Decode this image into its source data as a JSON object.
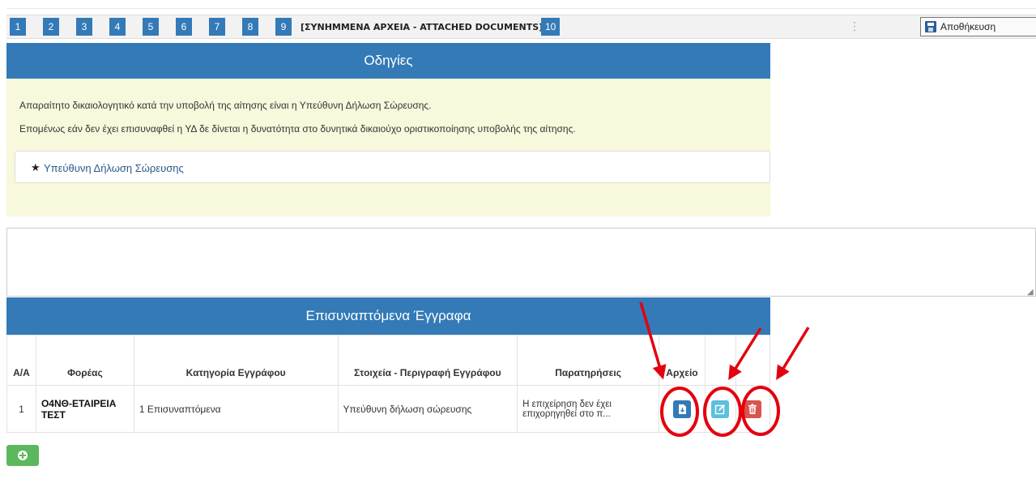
{
  "steps": [
    "1",
    "2",
    "3",
    "4",
    "5",
    "6",
    "7",
    "8",
    "9",
    "10"
  ],
  "current_step_title": "[ΣΥΝΗΜΜΕΝΑ ΑΡΧΕΙΑ - ATTACHED DOCUMENTS]",
  "toolbar": {
    "save_label": "Αποθήκευση"
  },
  "instructions": {
    "title": "Οδηγίες",
    "line1": "Απαραίτητο δικαιολογητικό κατά την υποβολή της αίτησης είναι η Υπεύθυνη Δήλωση Σώρευσης.",
    "line2": "Επομένως εάν δεν έχει επισυναφθεί η ΥΔ δε δίνεται η δυνατότητα στο δυνητικά δικαιούχο οριστικοποίησης υποβολής της αίτησης.",
    "required_doc": "Υπεύθυνη Δήλωση Σώρευσης"
  },
  "documents": {
    "title": "Επισυναπτόμενα Έγγραφα",
    "columns": {
      "aa": "Α/Α",
      "org": "Φορέας",
      "category": "Κατηγορία Εγγράφου",
      "description": "Στοιχεία - Περιγραφή Εγγράφου",
      "notes": "Παρατηρήσεις",
      "file": "Αρχείο"
    },
    "rows": [
      {
        "aa": "1",
        "org": "Ο4ΝΘ-ΕΤΑΙΡΕΙΑ ΤΕΣΤ",
        "category": "1 Επισυναπτόμενα",
        "description": "Υπεύθυνη δήλωση σώρευσης",
        "notes": "Η επιχείρηση δεν έχει επιχορηγηθεί στο π..."
      }
    ]
  },
  "icons": {
    "save": "floppy-disk-icon",
    "star": "star-icon",
    "file": "file-download-icon",
    "edit": "edit-icon",
    "delete": "trash-icon",
    "add": "plus-circle-icon"
  },
  "colors": {
    "primary": "#337ab7",
    "instructions_bg": "#f8f8dc",
    "edit": "#5bc0de",
    "delete": "#d9534f",
    "add": "#5cb85c",
    "annotation": "#e3000f"
  }
}
